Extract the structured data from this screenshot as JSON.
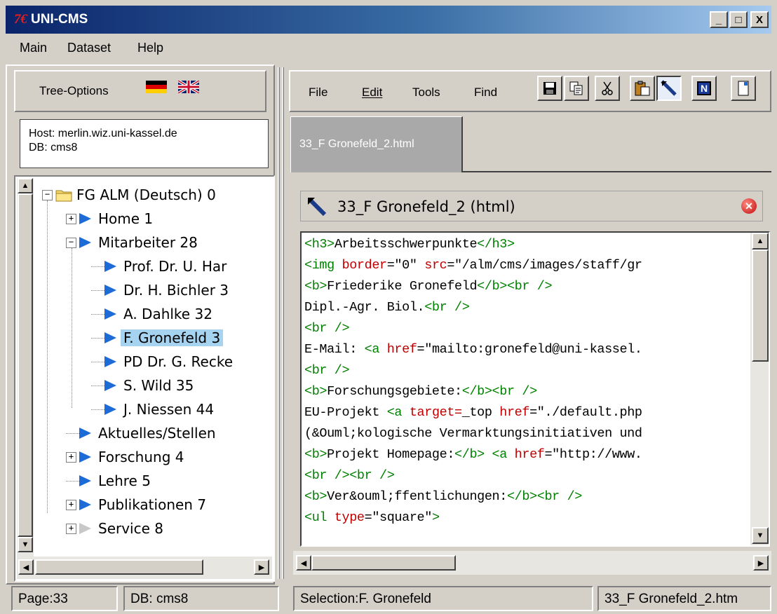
{
  "window": {
    "logo": "7€",
    "title": "UNI-CMS",
    "minimize": "_",
    "maximize": "□",
    "close": "X"
  },
  "menubar": [
    "Main",
    "Dataset",
    "Help"
  ],
  "left": {
    "tree_options_label": "Tree-Options",
    "host": "Host: merlin.wiz.uni-kassel.de",
    "db": "DB: cms8",
    "tree": [
      {
        "label": "FG ALM (Deutsch)  0",
        "level": 0,
        "expander": "−",
        "icon": "folder-icon"
      },
      {
        "label": "Home  1",
        "level": 1,
        "expander": "+",
        "icon": "triangle"
      },
      {
        "label": "Mitarbeiter  28",
        "level": 1,
        "expander": "−",
        "icon": "triangle"
      },
      {
        "label": "Prof. Dr. U. Har",
        "level": 2,
        "expander": "",
        "icon": "triangle"
      },
      {
        "label": "Dr. H. Bichler  3",
        "level": 2,
        "expander": "",
        "icon": "triangle"
      },
      {
        "label": "A. Dahlke  32",
        "level": 2,
        "expander": "",
        "icon": "triangle"
      },
      {
        "label": "F. Gronefeld  3",
        "level": 2,
        "expander": "",
        "icon": "triangle",
        "selected": true
      },
      {
        "label": "PD Dr. G. Recke",
        "level": 2,
        "expander": "",
        "icon": "triangle"
      },
      {
        "label": "S. Wild  35",
        "level": 2,
        "expander": "",
        "icon": "triangle"
      },
      {
        "label": "J. Niessen  44",
        "level": 2,
        "expander": "",
        "icon": "triangle"
      },
      {
        "label": "Aktuelles/Stellen",
        "level": 1,
        "expander": "",
        "icon": "triangle"
      },
      {
        "label": "Forschung  4",
        "level": 1,
        "expander": "+",
        "icon": "triangle"
      },
      {
        "label": "Lehre  5",
        "level": 1,
        "expander": "",
        "icon": "triangle"
      },
      {
        "label": "Publikationen  7",
        "level": 1,
        "expander": "+",
        "icon": "triangle"
      },
      {
        "label": "Service  8",
        "level": 1,
        "expander": "+",
        "icon": "triangle-grey"
      }
    ]
  },
  "right": {
    "menus": [
      "File",
      "Edit",
      "Tools",
      "Find"
    ],
    "menu_underline": [
      "",
      "E",
      "T",
      "i"
    ],
    "toolbar": [
      "save-icon",
      "copy-icon",
      "cut-icon",
      "paste-icon",
      "edit-tool-icon",
      "n-icon",
      "new-page-icon"
    ],
    "tab_label": "33_F Gronefeld_2.html",
    "doc_title": "33_F Gronefeld_2 (html)",
    "code_lines": [
      [
        [
          "tg",
          "<h3>"
        ],
        [
          "",
          "Arbeitsschwerpunkte"
        ],
        [
          "tg",
          "</h3>"
        ]
      ],
      [
        [
          "tg",
          "<img "
        ],
        [
          "at",
          "border"
        ],
        [
          "",
          "=\"0\" "
        ],
        [
          "at",
          "src"
        ],
        [
          "",
          "=\"/alm/cms/images/staff/gr"
        ]
      ],
      [
        [
          "tg",
          "<b>"
        ],
        [
          "",
          "Friederike Gronefeld"
        ],
        [
          "tg",
          "</b><br />"
        ]
      ],
      [
        [
          "",
          "Dipl.-Agr. Biol."
        ],
        [
          "tg",
          "<br />"
        ]
      ],
      [
        [
          "tg",
          "<br />"
        ]
      ],
      [
        [
          "",
          "E-Mail: "
        ],
        [
          "tg",
          "<a "
        ],
        [
          "at",
          "href"
        ],
        [
          "",
          "=\"mailto:gronefeld@uni-kassel."
        ]
      ],
      [
        [
          "tg",
          "<br />"
        ]
      ],
      [
        [
          "tg",
          "<b>"
        ],
        [
          "",
          "Forschungsgebiete:"
        ],
        [
          "tg",
          "</b><br />"
        ]
      ],
      [
        [
          "",
          "EU-Projekt "
        ],
        [
          "tg",
          "<a "
        ],
        [
          "at",
          "target="
        ],
        [
          "",
          "_top "
        ],
        [
          "at",
          "href"
        ],
        [
          "",
          "=\"./default.php"
        ]
      ],
      [
        [
          "",
          "(&Ouml;kologische Vermarktungsinitiativen und"
        ]
      ],
      [
        [
          "tg",
          "<b>"
        ],
        [
          "",
          "Projekt Homepage:"
        ],
        [
          "tg",
          "</b> <a "
        ],
        [
          "at",
          "href"
        ],
        [
          "",
          "=\"http://www."
        ]
      ],
      [
        [
          "tg",
          "<br /><br />"
        ]
      ],
      [
        [
          "tg",
          "<b>"
        ],
        [
          "",
          "Ver&ouml;ffentlichungen:"
        ],
        [
          "tg",
          "</b><br />"
        ]
      ],
      [
        [
          "tg",
          "<ul "
        ],
        [
          "at",
          "type"
        ],
        [
          "",
          "=\"square\""
        ],
        [
          "tg",
          ">"
        ]
      ]
    ]
  },
  "status": {
    "page": "Page:33",
    "db": "DB: cms8",
    "selection": "Selection:F. Gronefeld",
    "file": "33_F Gronefeld_2.htm"
  }
}
